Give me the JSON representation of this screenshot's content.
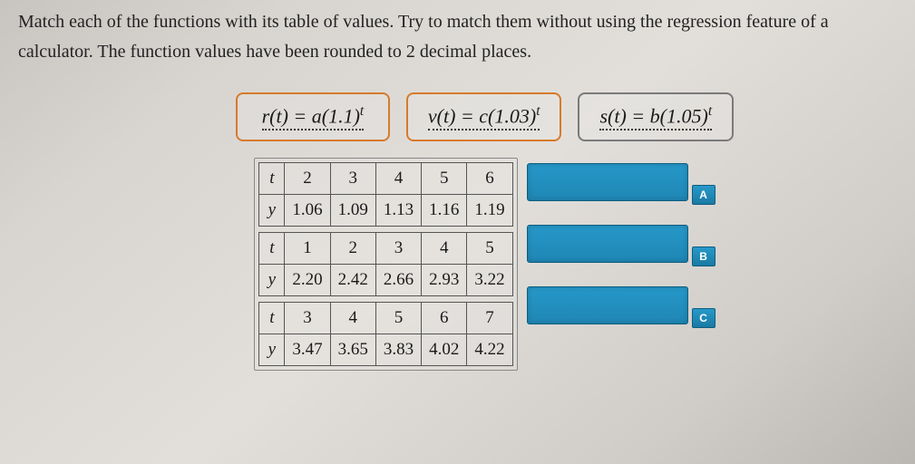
{
  "question": "Match each of the functions with its table of values. Try to match them without using the regression feature of a calculator. The function values have been rounded to 2 decimal places.",
  "functions": {
    "r": "r(t) = a(1.1)",
    "r_exp": "t",
    "v": "v(t) = c(1.03)",
    "v_exp": "t",
    "s": "s(t) = b(1.05)",
    "s_exp": "t"
  },
  "tables": [
    {
      "t_label": "t",
      "y_label": "y",
      "t": [
        "2",
        "3",
        "4",
        "5",
        "6"
      ],
      "y": [
        "1.06",
        "1.09",
        "1.13",
        "1.16",
        "1.19"
      ],
      "zone": "A"
    },
    {
      "t_label": "t",
      "y_label": "y",
      "t": [
        "1",
        "2",
        "3",
        "4",
        "5"
      ],
      "y": [
        "2.20",
        "2.42",
        "2.66",
        "2.93",
        "3.22"
      ],
      "zone": "B"
    },
    {
      "t_label": "t",
      "y_label": "y",
      "t": [
        "3",
        "4",
        "5",
        "6",
        "7"
      ],
      "y": [
        "3.47",
        "3.65",
        "3.83",
        "4.02",
        "4.22"
      ],
      "zone": "C"
    }
  ]
}
